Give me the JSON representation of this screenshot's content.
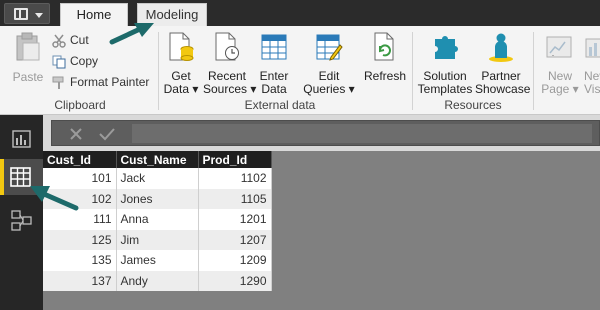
{
  "tabs": {
    "home": "Home",
    "modeling": "Modeling"
  },
  "clipboard": {
    "paste": "Paste",
    "cut": "Cut",
    "copy": "Copy",
    "format_painter": "Format Painter",
    "group": "Clipboard"
  },
  "external_data": {
    "get_data": [
      "Get",
      "Data"
    ],
    "recent_sources": [
      "Recent",
      "Sources"
    ],
    "enter_data": [
      "Enter",
      "Data"
    ],
    "edit_queries": [
      "Edit",
      "Queries"
    ],
    "refresh": "Refresh",
    "group": "External data"
  },
  "resources": {
    "solution_templates": [
      "Solution",
      "Templates"
    ],
    "partner_showcase": [
      "Partner",
      "Showcase"
    ],
    "group": "Resources"
  },
  "insert": {
    "new_page": [
      "New",
      "Page"
    ],
    "new_visual": [
      "New",
      "Vis"
    ]
  },
  "table": {
    "columns": [
      "Cust_Id",
      "Cust_Name",
      "Prod_Id"
    ],
    "rows": [
      [
        "101",
        "Jack",
        "1102"
      ],
      [
        "102",
        "Jones",
        "1105"
      ],
      [
        "111",
        "Anna",
        "1201"
      ],
      [
        "125",
        "Jim",
        "1207"
      ],
      [
        "135",
        "James",
        "1209"
      ],
      [
        "137",
        "Andy",
        "1290"
      ]
    ]
  },
  "colors": {
    "accent_yellow": "#f2c811",
    "arrow_teal": "#1d6a6a",
    "icon_blue": "#2a7ab8",
    "icon_teal": "#1f8fb0"
  }
}
